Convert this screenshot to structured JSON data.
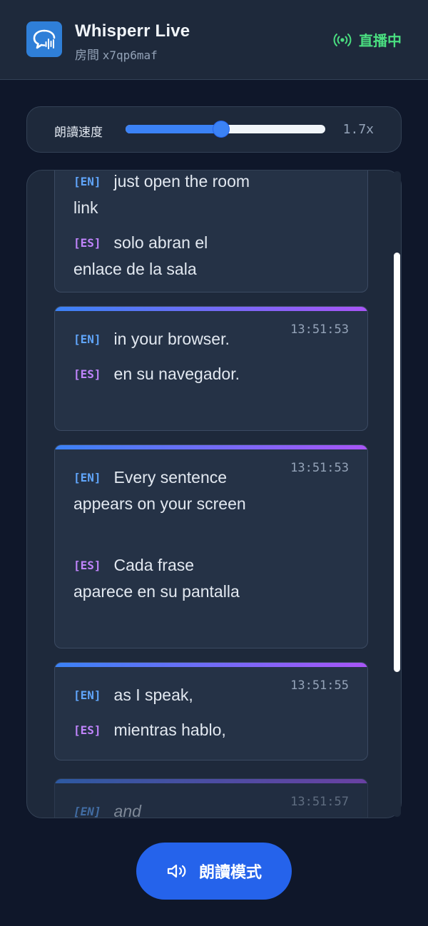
{
  "header": {
    "app_title": "Whisperr Live",
    "room_label": "房間",
    "room_code": "x7qp6maf",
    "live_label": "直播中",
    "live_color": "#4ade80",
    "logo_icon": "chat-bubble-waveform-icon"
  },
  "speed": {
    "label": "朗讀速度",
    "value_text": "1.7x",
    "slider_fraction": 0.48
  },
  "messages": [
    {
      "en_tag": "[EN]",
      "en": "just open the room link",
      "es_tag": "[ES]",
      "es": "solo abran el enlace de la sala",
      "time": ""
    },
    {
      "en_tag": "[EN]",
      "en": "in your browser.",
      "es_tag": "[ES]",
      "es": "en su navegador.",
      "time": "13:51:53"
    },
    {
      "en_tag": "[EN]",
      "en": "Every sentence appears on your screen",
      "es_tag": "[ES]",
      "es": "Cada frase aparece en su pantalla",
      "time": "13:51:53"
    },
    {
      "en_tag": "[EN]",
      "en": "as I speak,",
      "es_tag": "[ES]",
      "es": "mientras hablo,",
      "time": "13:51:55"
    },
    {
      "en_tag": "[EN]",
      "en": "and",
      "time": "13:51:57",
      "pending": true
    }
  ],
  "scroll_fraction": 0.36,
  "read_mode_button": {
    "label": "朗讀模式",
    "icon": "speaker-icon"
  },
  "colors": {
    "accent": "#3b82f6",
    "en_tag": "#60a5fa",
    "es_tag": "#c084fc",
    "background": "#0f172a"
  }
}
